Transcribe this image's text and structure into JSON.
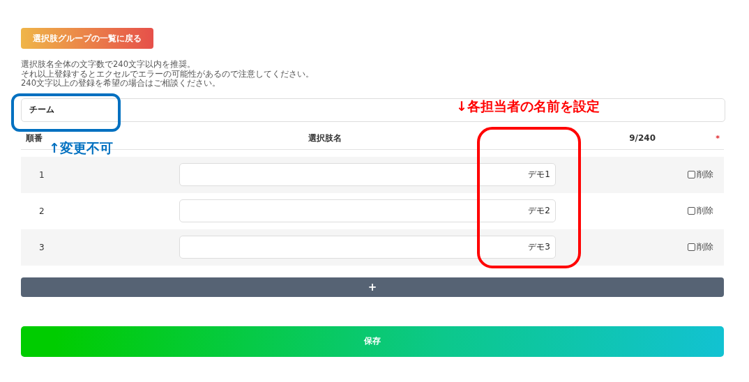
{
  "back_button": {
    "label": "選択肢グループの一覧に戻る"
  },
  "notes": [
    "選択肢名全体の文字数で240文字以内を推奨。",
    "それ以上登録するとエクセルでエラーの可能性があるので注意してください。",
    "240文字以上の登録を希望の場合はご相談ください。"
  ],
  "group_name": {
    "value": "チーム"
  },
  "table": {
    "columns": [
      "順番",
      "選択肢名",
      "9/240"
    ],
    "required_mark": "*",
    "rows": [
      {
        "order": "1",
        "value": "デモ1",
        "delete_label": "削除",
        "delete_checked": false
      },
      {
        "order": "2",
        "value": "デモ2",
        "delete_label": "削除",
        "delete_checked": false
      },
      {
        "order": "3",
        "value": "デモ3",
        "delete_label": "削除",
        "delete_checked": false
      }
    ]
  },
  "add_button": {
    "label": "+"
  },
  "save_button": {
    "label": "保存"
  },
  "annotations": [
    {
      "kind": "box",
      "color": "#0070c0"
    },
    {
      "kind": "label",
      "text": "↑変更不可",
      "color": "#0070c0"
    },
    {
      "kind": "label",
      "text": "↓各担当者の名前を設定",
      "color": "#ff0000"
    },
    {
      "kind": "box",
      "color": "#ff0000"
    }
  ]
}
